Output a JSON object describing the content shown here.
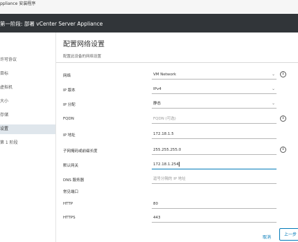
{
  "window": {
    "title": "ppliance 安装程序"
  },
  "header": {
    "title": "第一阶段: 部署 vCenter Server Appliance"
  },
  "sidebar": {
    "steps": [
      {
        "label": "许可协议"
      },
      {
        "label": "目标"
      },
      {
        "label": "虚拟机"
      },
      {
        "label": "大小"
      },
      {
        "label": "存储"
      },
      {
        "label": "设置",
        "active": true
      },
      {
        "label": "第 1 阶段"
      }
    ]
  },
  "main": {
    "title": "配置网络设置",
    "subtitle": "配置此设备的网络设置",
    "fields": {
      "network": {
        "label": "网络",
        "value": "VM Network",
        "info": "i"
      },
      "ip_version": {
        "label": "IP 版本",
        "value": "IPv4"
      },
      "ip_assignment": {
        "label": "IP 分配",
        "value": "静态"
      },
      "fqdn": {
        "label": "FQDN",
        "placeholder": "FQDN (可选)",
        "info": "i"
      },
      "ip_address": {
        "label": "IP 地址",
        "value": "172.18.1.5"
      },
      "subnet": {
        "label": "子网掩码或前缀长度",
        "value": "255.255.255.0",
        "info": "i"
      },
      "gateway": {
        "label": "默认网关",
        "value": "172.18.1.254"
      },
      "dns": {
        "label": "DNS 服务器",
        "placeholder": "逗号分隔的 IP 地址"
      },
      "common_ports": {
        "label": "常见端口"
      },
      "http": {
        "label": "HTTP",
        "value": "80"
      },
      "https": {
        "label": "HTTPS",
        "value": "443"
      }
    }
  },
  "footer": {
    "back_label": "上一步",
    "cancel_label": "取消"
  },
  "colors": {
    "header_bg": "#313539",
    "accent": "#0079b8",
    "active_step_bg": "#dfe6ec"
  }
}
